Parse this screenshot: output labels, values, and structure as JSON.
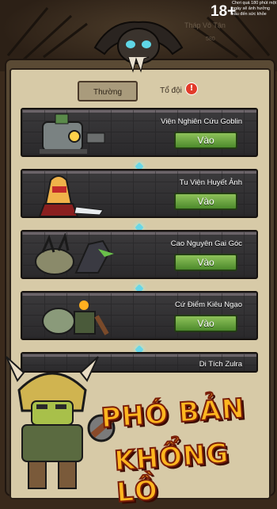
{
  "header": {
    "age_rating": "18+",
    "age_note": "Chơi quá 180 phút một ngày sẽ ảnh hưởng xấu đến sức khỏe",
    "faded_title": "Tháp Vô Tận",
    "faded_number": "580"
  },
  "tabs": [
    {
      "label": "Thường",
      "selected": true
    },
    {
      "label": "Tổ đội",
      "selected": false,
      "badge": "!"
    }
  ],
  "dungeons": [
    {
      "name": "Viện Nghiên Cứu Goblin",
      "button": "Vào"
    },
    {
      "name": "Tu Viện Huyết Ảnh",
      "button": "Vào"
    },
    {
      "name": "Cao Nguyên Gai Góc",
      "button": "Vào"
    },
    {
      "name": "Cứ Điểm Kiêu Ngạo",
      "button": "Vào"
    },
    {
      "name": "Di Tích Zulra",
      "button": ""
    }
  ],
  "banner": {
    "line1": "PHÓ BẢN",
    "line2": "KHỔNG LỒ"
  },
  "colors": {
    "accent_green": "#6aa63e",
    "banner_gold": "#ffb61f",
    "alert_red": "#e23b2a",
    "panel_bg": "#d7caa7"
  }
}
